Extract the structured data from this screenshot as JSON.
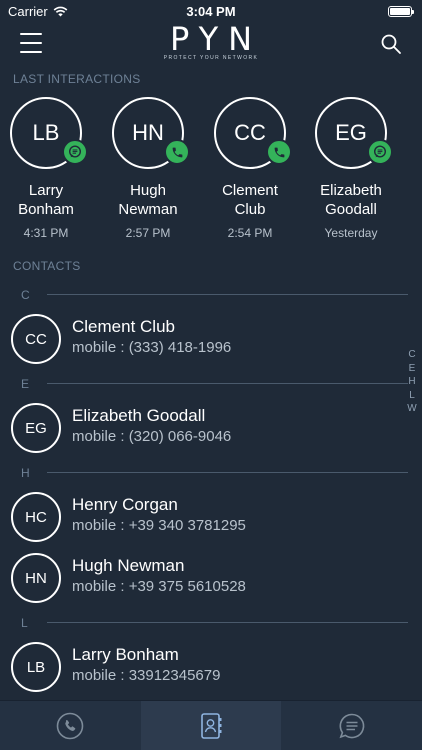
{
  "status": {
    "carrier": "Carrier",
    "time": "3:04 PM"
  },
  "header": {
    "logo": "PYN",
    "tagline": "PROTECT YOUR NETWORK"
  },
  "sections": {
    "recent": "LAST INTERACTIONS",
    "contacts": "CONTACTS"
  },
  "recent": [
    {
      "initials": "LB",
      "name_line1": "Larry",
      "name_line2": "Bonham",
      "time": "4:31 PM",
      "badge": "message-icon"
    },
    {
      "initials": "HN",
      "name_line1": "Hugh",
      "name_line2": "Newman",
      "time": "2:57 PM",
      "badge": "phone-icon"
    },
    {
      "initials": "CC",
      "name_line1": "Clement",
      "name_line2": "Club",
      "time": "2:54 PM",
      "badge": "phone-icon"
    },
    {
      "initials": "EG",
      "name_line1": "Elizabeth",
      "name_line2": "Goodall",
      "time": "Yesterday",
      "badge": "message-icon"
    }
  ],
  "contact_groups": [
    {
      "letter": "C",
      "contacts": [
        {
          "initials": "CC",
          "name": "Clement Club",
          "phone": "mobile : (333) 418-1996"
        }
      ]
    },
    {
      "letter": "E",
      "contacts": [
        {
          "initials": "EG",
          "name": "Elizabeth Goodall",
          "phone": "mobile : (320) 066-9046"
        }
      ]
    },
    {
      "letter": "H",
      "contacts": [
        {
          "initials": "HC",
          "name": "Henry Corgan",
          "phone": "mobile : +39 340 3781295"
        },
        {
          "initials": "HN",
          "name": "Hugh Newman",
          "phone": "mobile : +39 375 5610528"
        }
      ]
    },
    {
      "letter": "L",
      "contacts": [
        {
          "initials": "LB",
          "name": "Larry Bonham",
          "phone": "mobile : 33912345679"
        }
      ]
    }
  ],
  "index_letters": [
    "C",
    "E",
    "H",
    "L",
    "W"
  ],
  "tabs": [
    {
      "name": "calls",
      "icon": "phone-icon",
      "active": false
    },
    {
      "name": "contacts",
      "icon": "contacts-book-icon",
      "active": true
    },
    {
      "name": "messages",
      "icon": "chat-bubble-icon",
      "active": false
    }
  ],
  "colors": {
    "background": "#1f2a38",
    "badge_green": "#34b35a",
    "tab_bar": "#243142",
    "muted_text": "#6e8196"
  }
}
